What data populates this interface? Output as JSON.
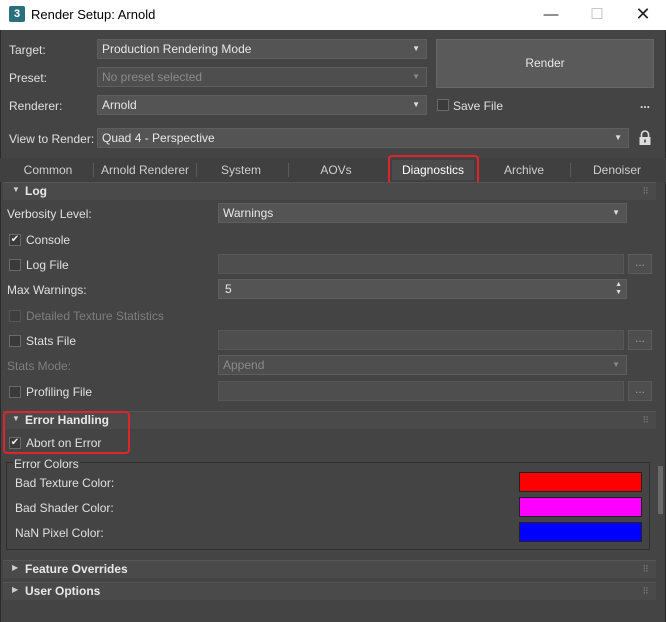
{
  "window": {
    "icon_label": "3",
    "title": "Render Setup: Arnold",
    "minimize_glyph": "—",
    "maximize_glyph": "☐",
    "close_glyph": "✕"
  },
  "header": {
    "target_label": "Target:",
    "target_value": "Production Rendering Mode",
    "preset_label": "Preset:",
    "preset_value": "No preset selected",
    "renderer_label": "Renderer:",
    "renderer_value": "Arnold",
    "save_file_label": "Save File",
    "save_file_checked": false,
    "more_glyph": "...",
    "view_label": "View to Render:",
    "view_value": "Quad 4 - Perspective",
    "render_button": "Render",
    "lock_icon": "lock-icon"
  },
  "tabs": [
    {
      "label": "Common"
    },
    {
      "label": "Arnold Renderer"
    },
    {
      "label": "System"
    },
    {
      "label": "AOVs"
    },
    {
      "label": "Diagnostics",
      "active": true
    },
    {
      "label": "Archive"
    },
    {
      "label": "Denoiser"
    }
  ],
  "log": {
    "title": "Log",
    "verbosity_label": "Verbosity Level:",
    "verbosity_value": "Warnings",
    "console_label": "Console",
    "console_checked": true,
    "log_file_label": "Log File",
    "max_warnings_label": "Max Warnings:",
    "max_warnings_value": "5",
    "detailed_texture_label": "Detailed Texture Statistics",
    "stats_file_label": "Stats File",
    "stats_mode_label": "Stats Mode:",
    "stats_mode_value": "Append",
    "profiling_file_label": "Profiling File",
    "browse_glyph": "..."
  },
  "error_handling": {
    "title": "Error Handling",
    "abort_label": "Abort on Error",
    "abort_checked": true,
    "group_label": "Error Colors",
    "bad_texture_label": "Bad Texture Color:",
    "bad_shader_label": "Bad Shader Color:",
    "nan_pixel_label": "NaN Pixel Color:",
    "colors": {
      "bad_texture": "#ff0000",
      "bad_shader": "#ff00ff",
      "nan_pixel": "#0000ff"
    }
  },
  "collapsed_rollouts": {
    "feature_overrides": "Feature Overrides",
    "user_options": "User Options"
  },
  "glyphs": {
    "check": "✔",
    "dropdown": "▼",
    "expanded": "▼",
    "collapsed": "▶",
    "spin_up": "▲",
    "spin_down": "▼",
    "grip": "⠿"
  },
  "highlight_color": "#e0242e"
}
